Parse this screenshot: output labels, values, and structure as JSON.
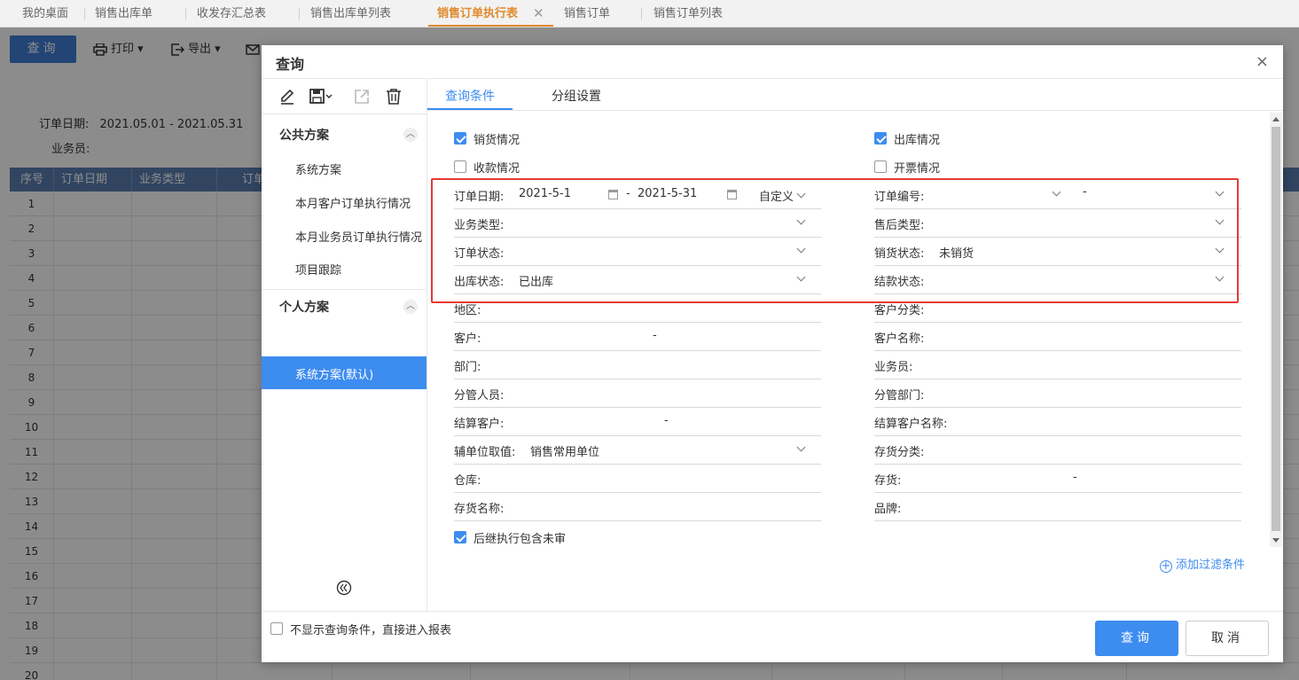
{
  "tabs": [
    {
      "label": "我的桌面"
    },
    {
      "label": "销售出库单"
    },
    {
      "label": "收发存汇总表"
    },
    {
      "label": "销售出库单列表"
    },
    {
      "label": "销售订单执行表",
      "active": true
    },
    {
      "label": "销售订单"
    },
    {
      "label": "销售订单列表"
    }
  ],
  "tab_close": "✕",
  "toolbar": {
    "query_label": "查询",
    "print_label": "打印",
    "export_label": "导出"
  },
  "filters": {
    "order_date_label": "订单日期:",
    "order_date_value": "2021.05.01 - 2021.05.31",
    "salesperson_label": "业务员:"
  },
  "grid": {
    "headers": [
      "序号",
      "订单日期",
      "业务类型",
      "订单"
    ],
    "rows": [
      "1",
      "2",
      "3",
      "4",
      "5",
      "6",
      "7",
      "8",
      "9",
      "10",
      "11",
      "12",
      "13",
      "14",
      "15",
      "16",
      "17",
      "18",
      "19",
      "20"
    ]
  },
  "dialog": {
    "title": "查询",
    "close": "×",
    "left": {
      "public_group": "公共方案",
      "public_items": [
        "系统方案",
        "本月客户订单执行情况",
        "本月业务员订单执行情况",
        "项目跟踪"
      ],
      "personal_group": "个人方案",
      "personal_selected": "系统方案(默认)"
    },
    "tabs": {
      "conditions": "查询条件",
      "grouping": "分组设置"
    },
    "checkboxes": {
      "sales": "销货情况",
      "outbound": "出库情况",
      "receipts": "收款情况",
      "invoice": "开票情况",
      "include_unreviewed": "后继执行包含未审"
    },
    "fields": {
      "order_date": {
        "label": "订单日期:",
        "from": "2021-5-1",
        "to": "2021-5-31",
        "range_type": "自定义",
        "dash": "-"
      },
      "order_no": {
        "label": "订单编号:",
        "dash": "-"
      },
      "business_type": {
        "label": "业务类型:"
      },
      "aftersale_type": {
        "label": "售后类型:"
      },
      "order_status": {
        "label": "订单状态:"
      },
      "sales_status": {
        "label": "销货状态:",
        "value": "未销货"
      },
      "outbound_status": {
        "label": "出库状态:",
        "value": "已出库"
      },
      "settle_status": {
        "label": "结款状态:"
      },
      "region": {
        "label": "地区:"
      },
      "customer_category": {
        "label": "客户分类:"
      },
      "customer": {
        "label": "客户:",
        "dash": "-"
      },
      "customer_name": {
        "label": "客户名称:"
      },
      "department": {
        "label": "部门:"
      },
      "salesperson": {
        "label": "业务员:"
      },
      "manager": {
        "label": "分管人员:"
      },
      "manager_dept": {
        "label": "分管部门:"
      },
      "settle_customer": {
        "label": "结算客户:",
        "dash": "-"
      },
      "settle_customer_name": {
        "label": "结算客户名称:"
      },
      "aux_unit": {
        "label": "辅单位取值:",
        "value": "销售常用单位"
      },
      "stock_category": {
        "label": "存货分类:"
      },
      "warehouse": {
        "label": "仓库:"
      },
      "stock": {
        "label": "存货:",
        "dash": "-"
      },
      "stock_name": {
        "label": "存货名称:"
      },
      "brand": {
        "label": "品牌:"
      }
    },
    "add_filter": "添加过滤条件",
    "footer": {
      "skip_label": "不显示查询条件，直接进入报表",
      "ok": "查询",
      "cancel": "取消"
    }
  }
}
